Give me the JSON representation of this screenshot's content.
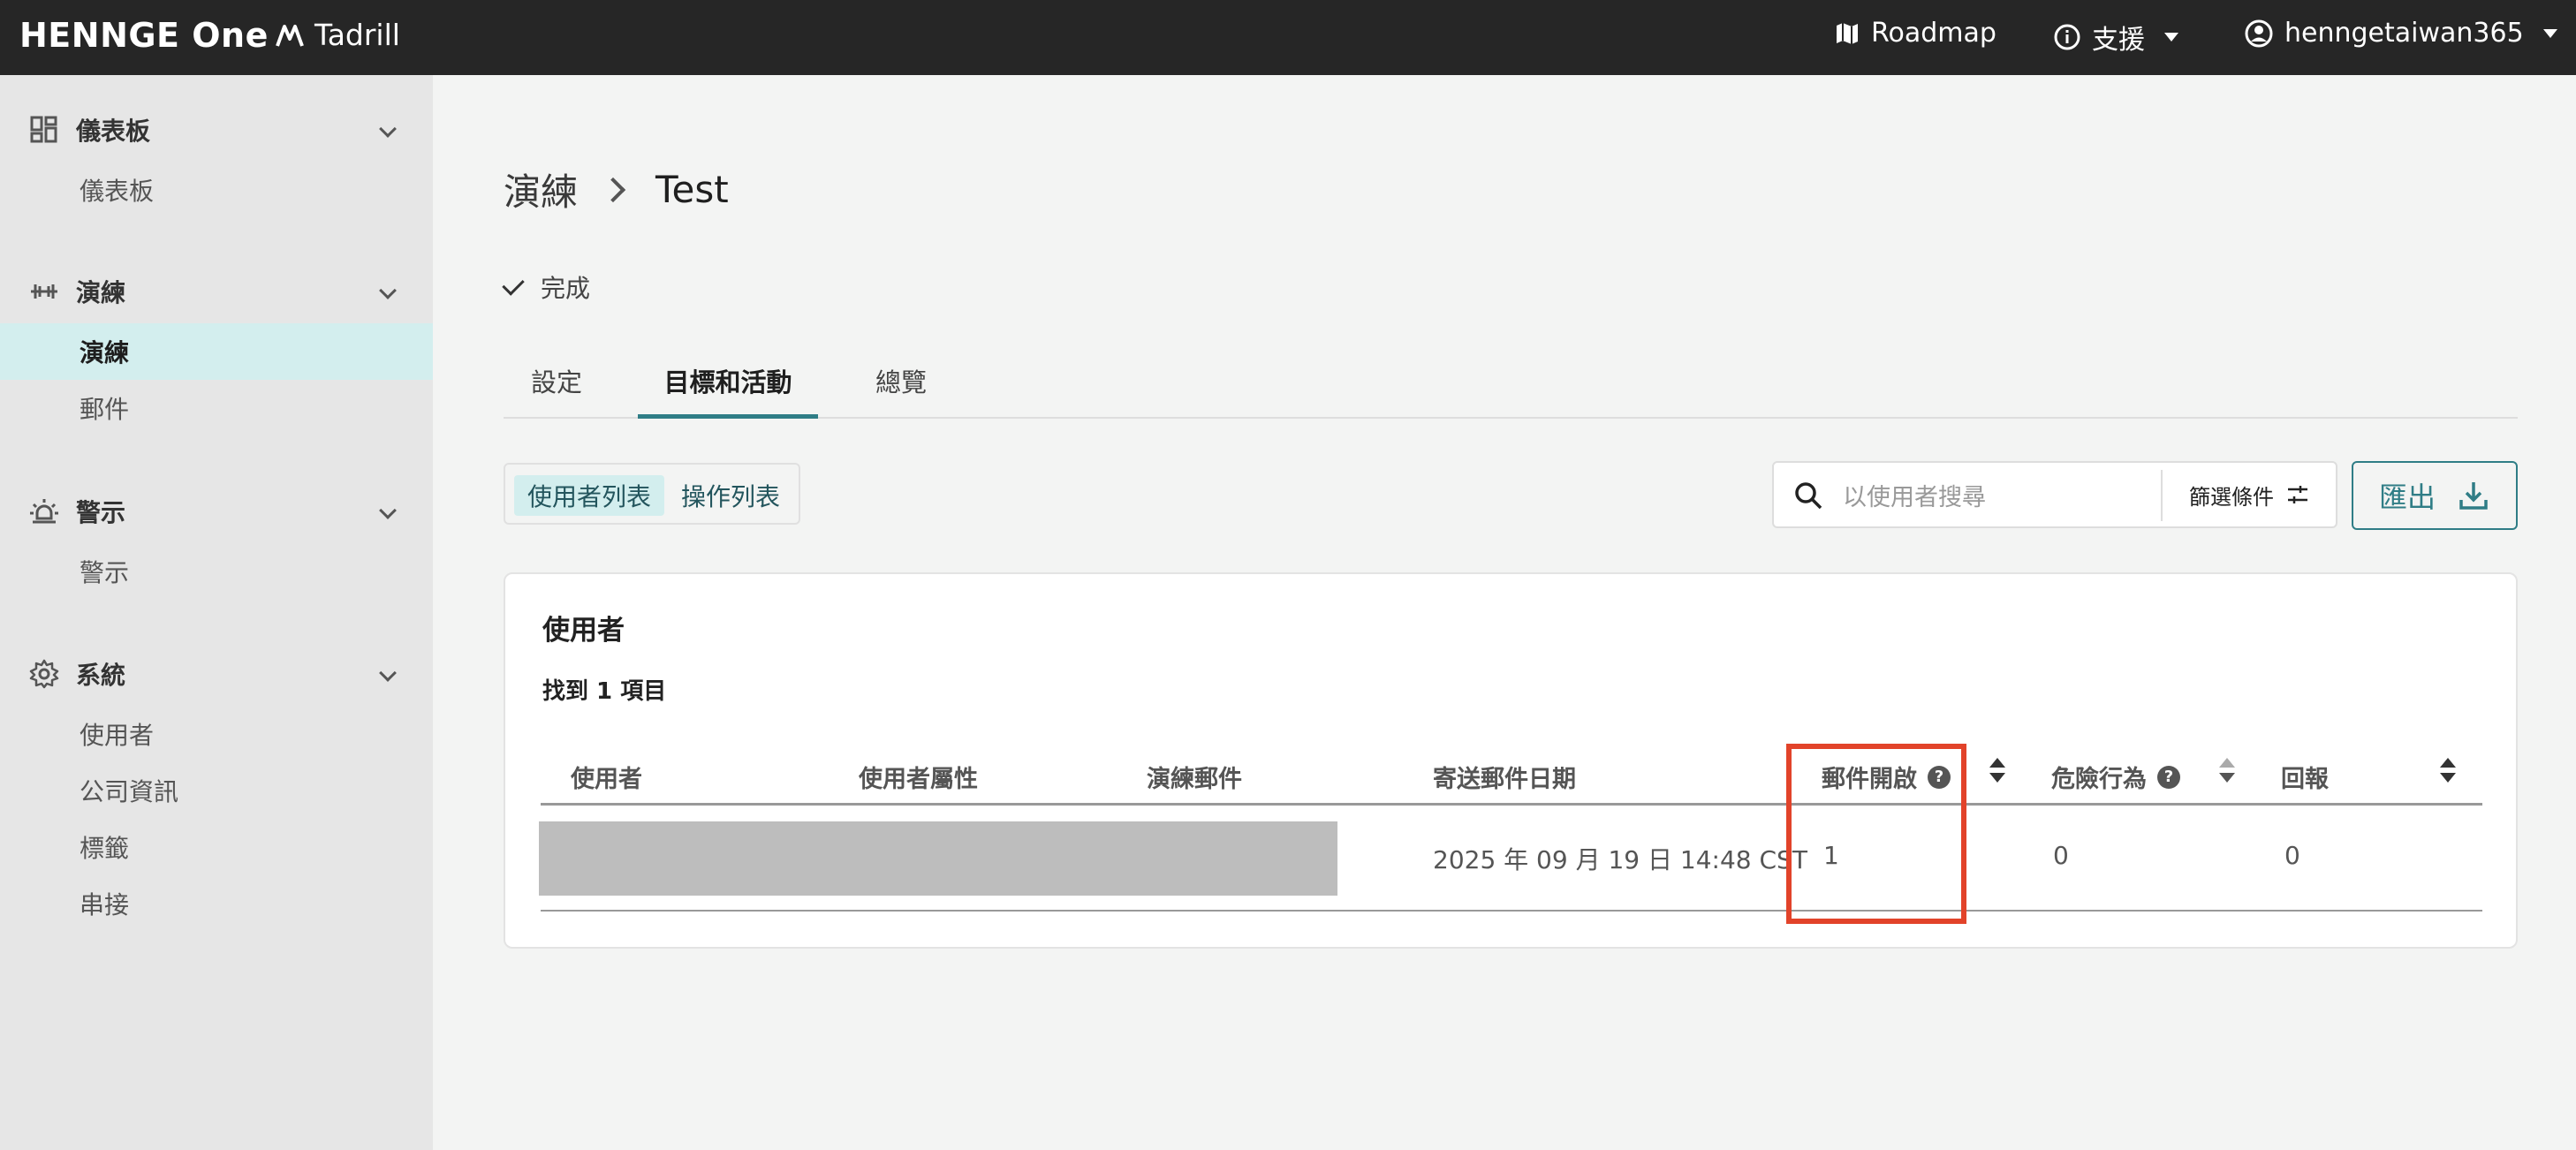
{
  "topbar": {
    "brand": "HENNGE One",
    "product": "Tadrill",
    "roadmap": "Roadmap",
    "support": "支援",
    "user": "henngetaiwan365"
  },
  "sidebar": {
    "sections": [
      {
        "title": "儀表板",
        "items": [
          "儀表板"
        ]
      },
      {
        "title": "演練",
        "items": [
          "演練",
          "郵件"
        ],
        "active": "演練"
      },
      {
        "title": "警示",
        "items": [
          "警示"
        ]
      },
      {
        "title": "系統",
        "items": [
          "使用者",
          "公司資訊",
          "標籤",
          "串接"
        ]
      }
    ]
  },
  "breadcrumb": {
    "parent": "演練",
    "current": "Test"
  },
  "status": "完成",
  "tabs": [
    "設定",
    "目標和活動",
    "總覽"
  ],
  "active_tab": "目標和活動",
  "segment": {
    "users": "使用者列表",
    "actions": "操作列表",
    "selected": "使用者列表"
  },
  "search": {
    "placeholder": "以使用者搜尋",
    "filter_label": "篩選條件"
  },
  "export_label": "匯出",
  "card": {
    "title": "使用者",
    "found": "找到 1 項目",
    "columns": [
      "使用者",
      "使用者屬性",
      "演練郵件",
      "寄送郵件日期",
      "郵件開啟",
      "危險行為",
      "回報"
    ],
    "rows": [
      {
        "sent_date": "2025 年 09 月 19 日 14:48 CST",
        "opened": "1",
        "risky": "0",
        "reported": "0"
      }
    ]
  },
  "colors": {
    "accent": "#2f7d86",
    "highlight": "#e2432a",
    "topbar": "#262626"
  }
}
